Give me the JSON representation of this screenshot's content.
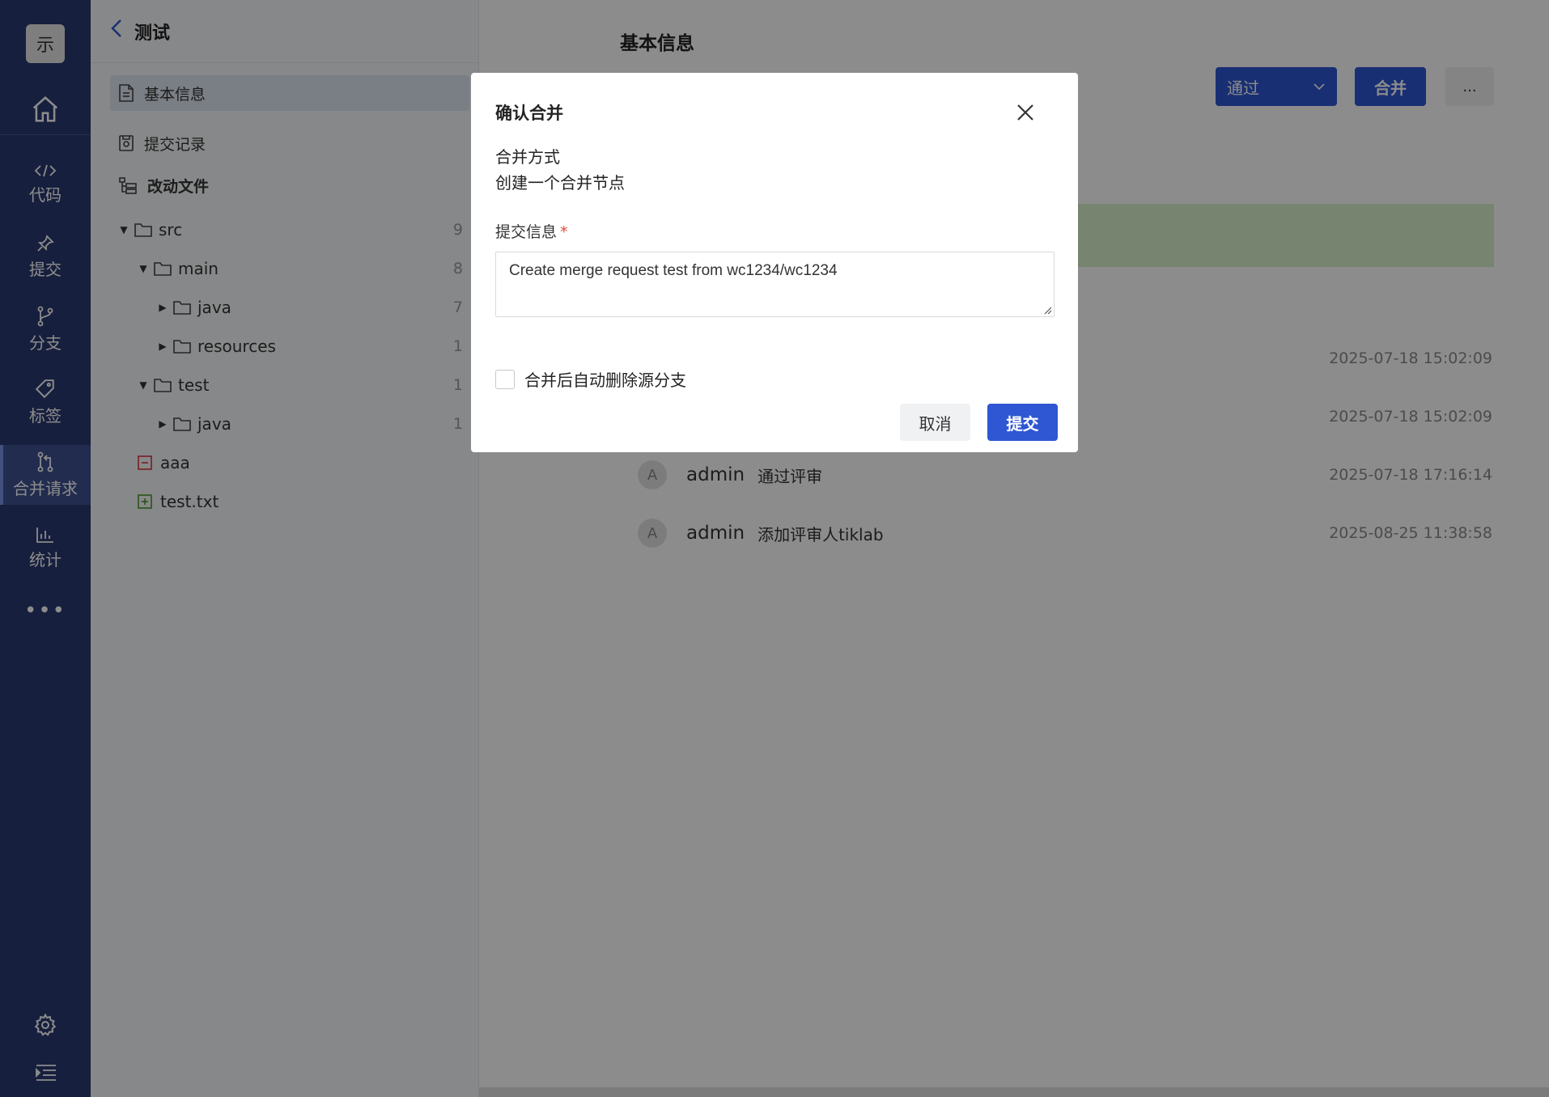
{
  "app": {
    "logo_text": "示"
  },
  "rail": {
    "items": [
      {
        "label": "代码",
        "icon": "code-icon"
      },
      {
        "label": "提交",
        "icon": "pin-icon"
      },
      {
        "label": "分支",
        "icon": "branch-icon"
      },
      {
        "label": "标签",
        "icon": "tag-icon"
      },
      {
        "label": "合并请求",
        "icon": "merge-request-icon",
        "active": true
      },
      {
        "label": "统计",
        "icon": "stats-icon"
      }
    ],
    "more": "•••"
  },
  "sidebar": {
    "title": "测试",
    "items": [
      {
        "label": "基本信息",
        "active": true
      },
      {
        "label": "提交记录"
      },
      {
        "label": "改动文件"
      }
    ],
    "tree": [
      {
        "name": "src",
        "count": "9"
      },
      {
        "name": "main",
        "count": "8"
      },
      {
        "name": "java",
        "count": "7"
      },
      {
        "name": "resources",
        "count": "1"
      },
      {
        "name": "test",
        "count": "1"
      },
      {
        "name": "java",
        "count": "1"
      },
      {
        "name": "aaa",
        "status": "deleted"
      },
      {
        "name": "test.txt",
        "status": "added"
      }
    ]
  },
  "main": {
    "title": "基本信息",
    "review_select": "通过",
    "merge_button": "合并",
    "more_button": "...",
    "activities": [
      {
        "time": "2025-07-18 15:02:09"
      },
      {
        "time": "2025-07-18 15:02:09"
      },
      {
        "avatar": "A",
        "user": "admin",
        "text": "通过评审",
        "time": "2025-07-18 17:16:14"
      },
      {
        "avatar": "A",
        "user": "admin",
        "text": "添加评审人tiklab",
        "time": "2025-08-25 11:38:58"
      }
    ]
  },
  "modal": {
    "title": "确认合并",
    "merge_method_label": "合并方式",
    "merge_method_value": "创建一个合并节点",
    "commit_label": "提交信息",
    "required_mark": "*",
    "commit_message": "Create merge request test from wc1234/wc1234",
    "auto_delete_label": "合并后自动删除源分支",
    "auto_delete_checked": false,
    "cancel": "取消",
    "submit": "提交"
  },
  "colors": {
    "primary": "#2f57d3",
    "rail_bg": "#2b3a72",
    "required": "#e04a3a"
  }
}
